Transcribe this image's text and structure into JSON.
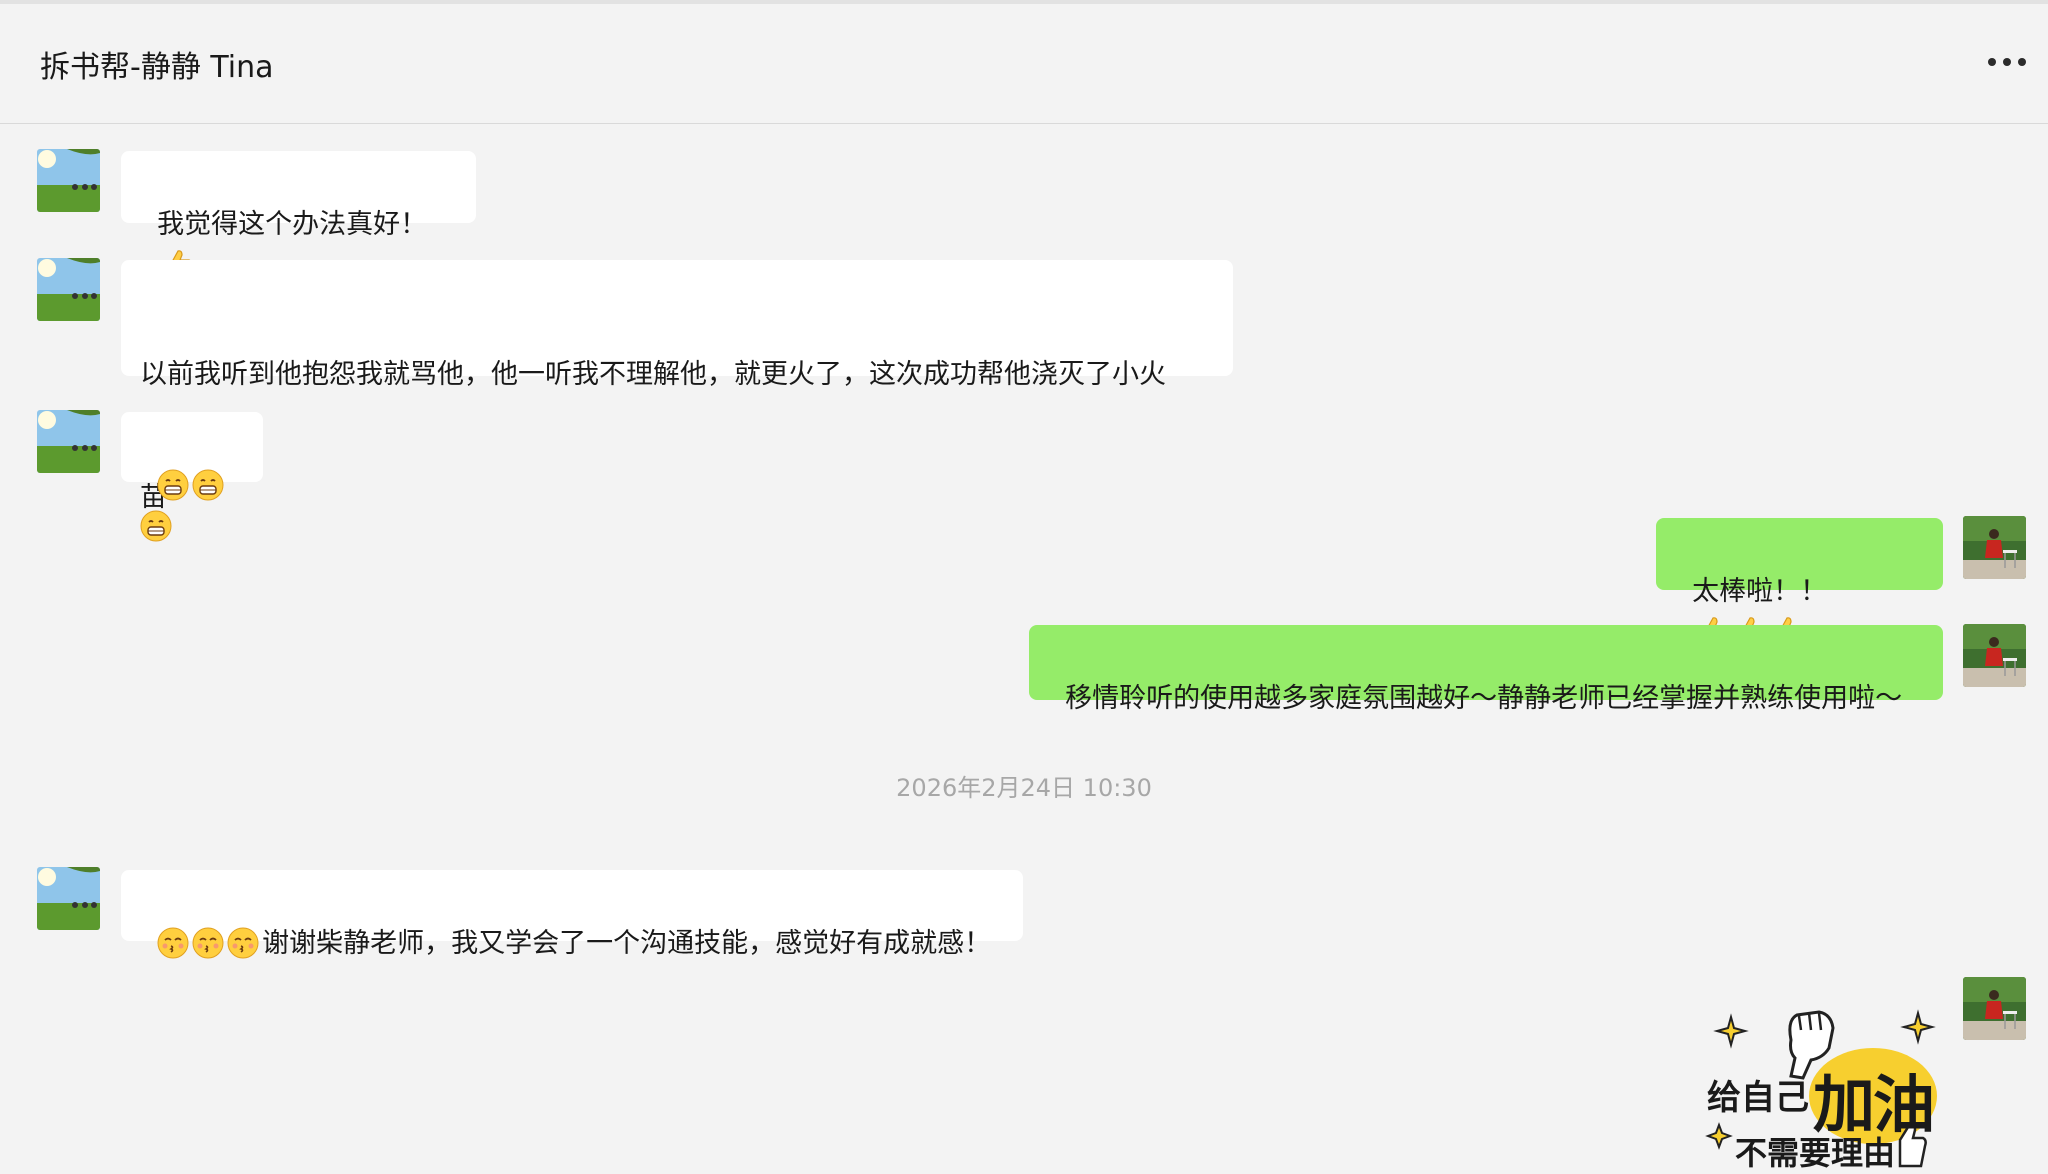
{
  "header": {
    "title": "拆书帮-静静 Tina",
    "more_icon": "more-icon"
  },
  "messages": [
    {
      "side": "in",
      "text": "我觉得这个办法真好！",
      "trailing_icons": [
        "thumbs-up-icon"
      ]
    },
    {
      "side": "in",
      "line1": "以前我听到他抱怨我就骂他，他一听我不理解他，就更火了，这次成功帮他浇灭了小火",
      "line2": "苗"
    },
    {
      "side": "in",
      "text": "",
      "leading_icons": [
        "grin-emoji-icon",
        "grin-emoji-icon",
        "grin-emoji-icon"
      ]
    },
    {
      "side": "out",
      "text": "太棒啦！！",
      "trailing_icons": [
        "thumbs-up-icon",
        "thumbs-up-icon",
        "thumbs-up-icon"
      ]
    },
    {
      "side": "out",
      "text": "移情聆听的使用越多家庭氛围越好～静静老师已经掌握并熟练使用啦～"
    },
    {
      "side": "in",
      "text": "谢谢柴静老师，我又学会了一个沟通技能，感觉好有成就感！",
      "leading_icons": [
        "kiss-emoji-icon",
        "kiss-emoji-icon",
        "kiss-emoji-icon"
      ]
    }
  ],
  "timestamp": "2026年2月24日 10:30",
  "sticker": {
    "line1_prefix": "给自己",
    "line1_highlight": "加油",
    "line2": "不需要理由"
  },
  "colors": {
    "background": "#f3f3f3",
    "incoming_bubble": "#ffffff",
    "outgoing_bubble": "#95ec69",
    "timestamp": "#a7a7a7",
    "sticker_accent": "#f7cf2f"
  }
}
